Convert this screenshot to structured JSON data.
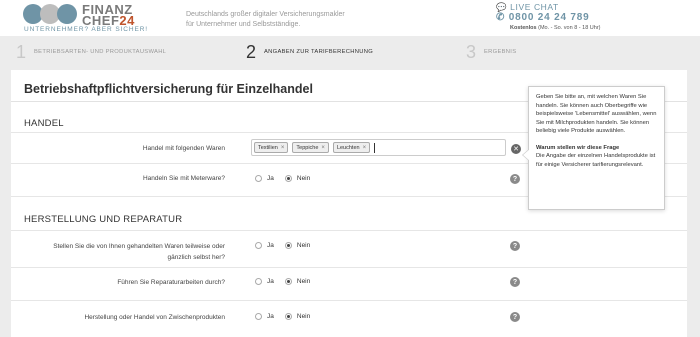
{
  "header": {
    "brand_line1": "FINANZ",
    "brand_line2a": "CHEF",
    "brand_line2b": "24",
    "brand_tagline": "UNTERNEHMER? ABER SICHER!",
    "tagline_line1": "Deutschlands großer digitaler Versicherungsmakler",
    "tagline_line2": "für Unternehmer und Selbstständige.",
    "live_chat": "LIVE CHAT",
    "phone": "0800 24 24 789",
    "hours_bold": "Kostenlos",
    "hours_rest": "(Mo. - So. von 8 - 18 Uhr)",
    "accent_color": "#6f94a6",
    "brand_color": "#c0552d"
  },
  "steps": [
    {
      "num": "1",
      "label": "BETRIEBSARTEN- UND PRODUKTAUSWAHL",
      "active": false
    },
    {
      "num": "2",
      "label": "ANGABEN ZUR TARIFBERECHNUNG",
      "active": true
    },
    {
      "num": "3",
      "label": "ERGEBNIS",
      "active": false
    }
  ],
  "main": {
    "title": "Betriebshaftpflichtversicherung für Einzelhandel",
    "section_handel": "HANDEL",
    "section_herstellung": "HERSTELLUNG UND REPARATUR",
    "q_waren": "Handel mit folgenden Waren",
    "tags": [
      "Textilien",
      "Teppiche",
      "Leuchten"
    ],
    "q_meterware": "Handeln Sie mit Meterware?",
    "q_selbst_line1": "Stellen Sie die von Ihnen gehandelten Waren teilweise oder",
    "q_selbst_line2": "gänzlich selbst her?",
    "q_reparatur": "Führen Sie Reparaturarbeiten durch?",
    "q_zwischen": "Herstellung oder Handel von Zwischenprodukten",
    "opt_ja": "Ja",
    "opt_nein": "Nein",
    "help_glyph": "?",
    "clear_glyph": "✕",
    "tag_remove": "×"
  },
  "tooltip": {
    "text": "Geben Sie bitte an, mit welchen Waren Sie handeln. Sie können auch Oberbegriffe wie beispielsweise 'Lebensmittel' auswählen, wenn Sie mit Milchprodukten handeln. Sie können beliebig viele Produkte auswählen.",
    "question": "Warum stellen wir diese Frage",
    "answer": "Die Angabe der einzelnen Handelsprodukte ist für einige Versicherer tarifierungsrelevant."
  }
}
